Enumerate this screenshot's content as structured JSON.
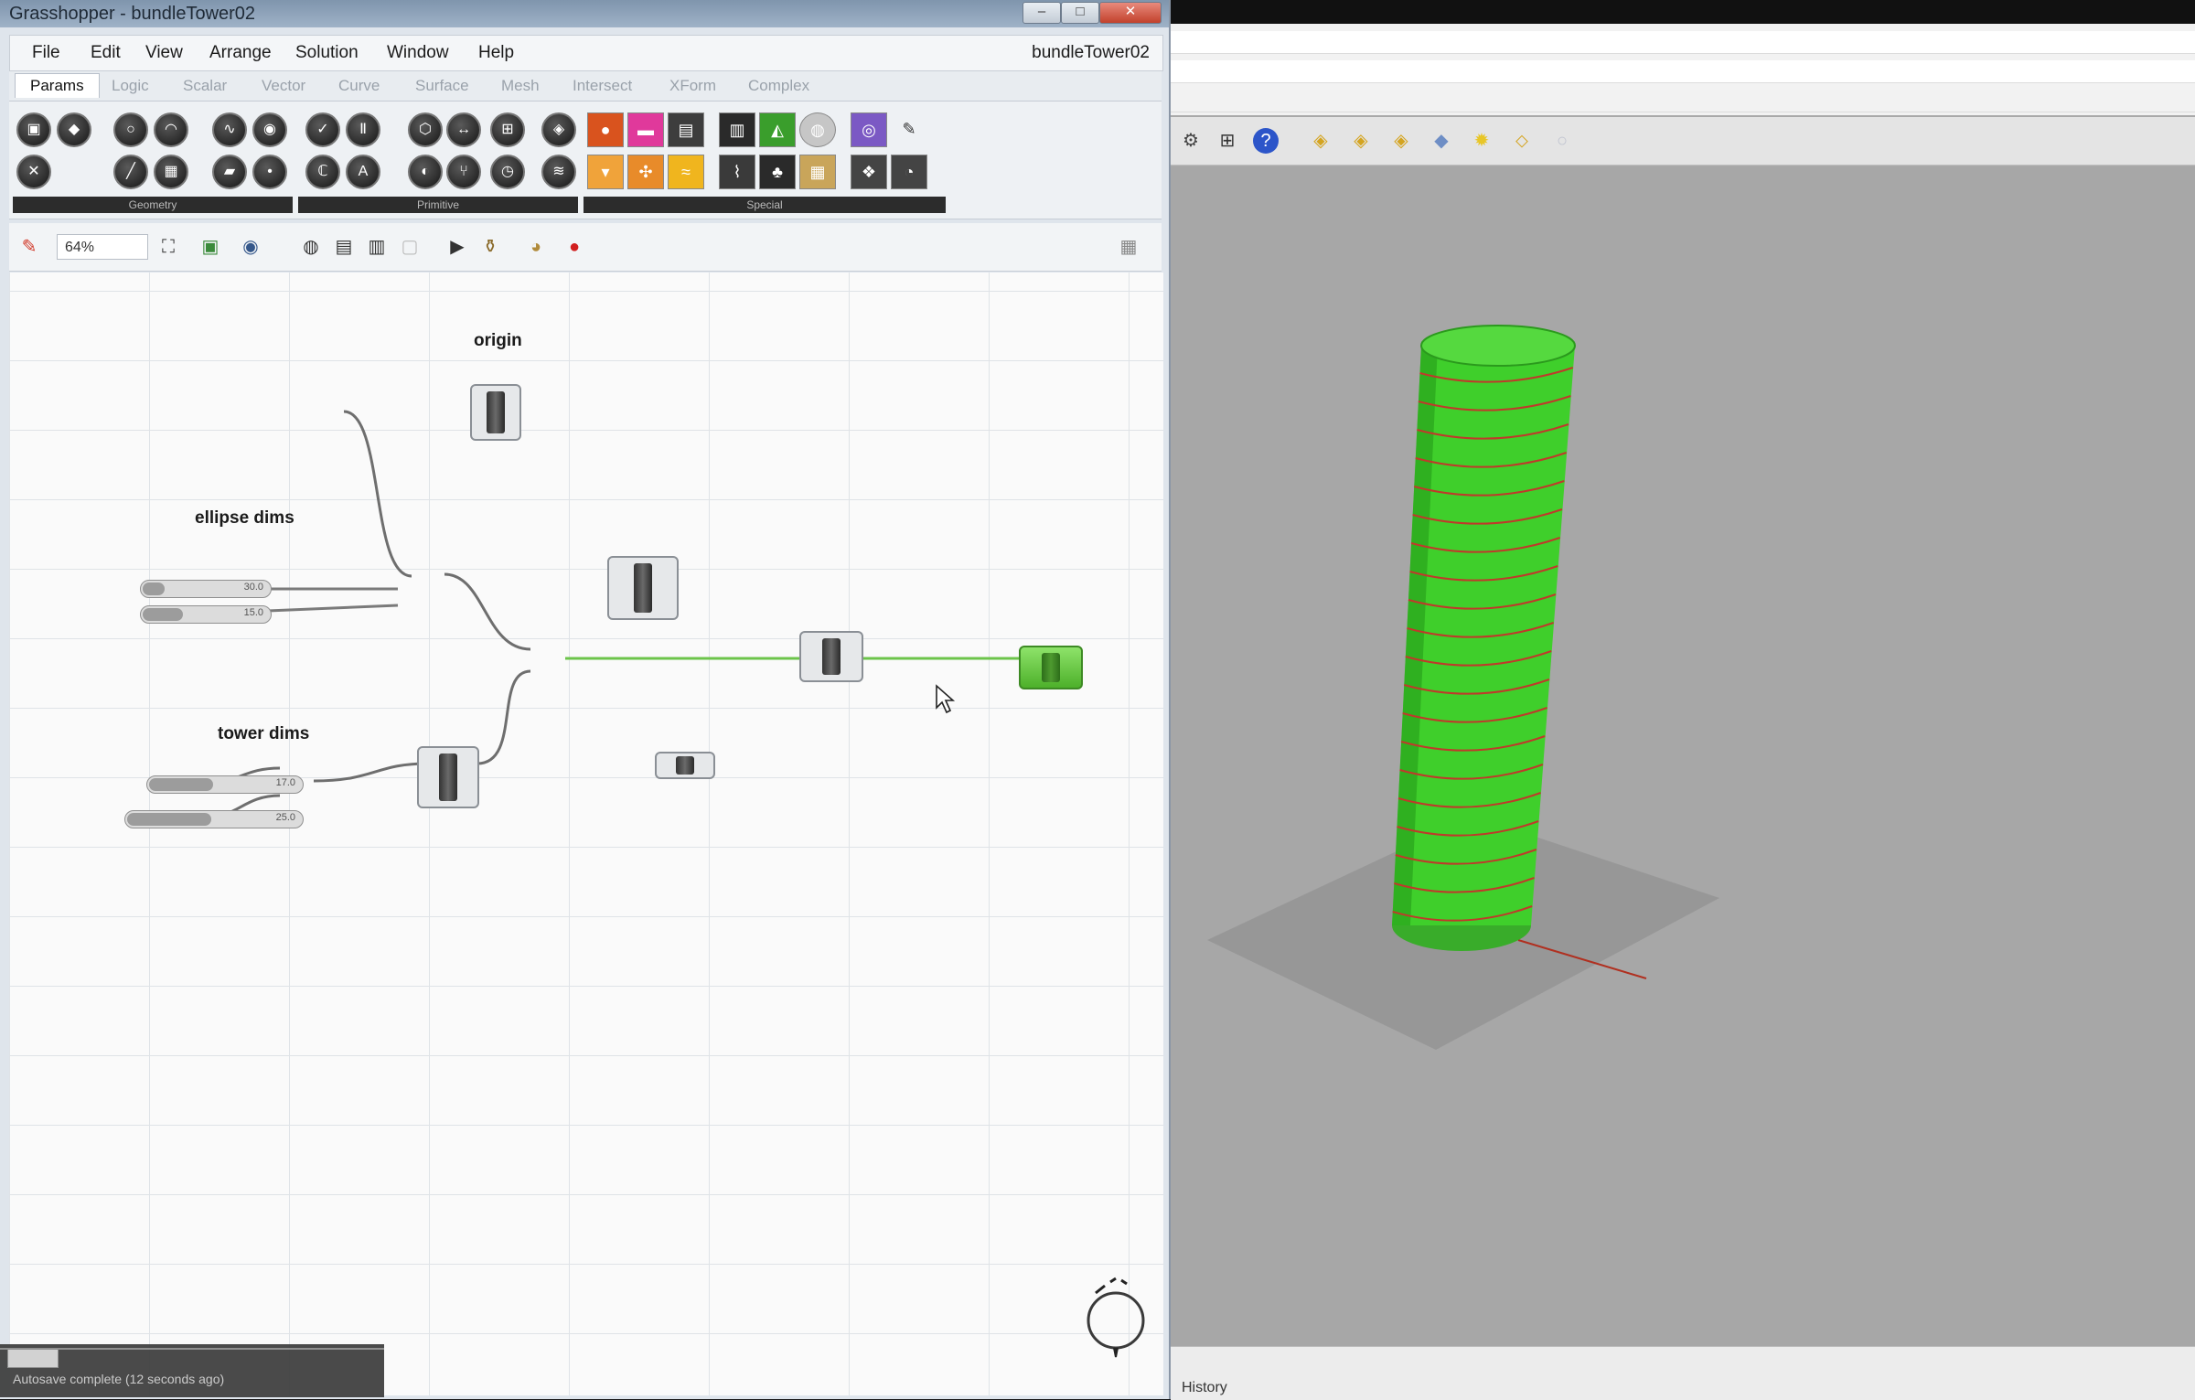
{
  "grasshopper": {
    "title": "Grasshopper - bundleTower02",
    "document_name": "bundleTower02",
    "menu": [
      "File",
      "Edit",
      "View",
      "Arrange",
      "Solution",
      "Window",
      "Help"
    ],
    "tabs": [
      "Params",
      "Logic",
      "Scalar",
      "Vector",
      "Curve",
      "Surface",
      "Mesh",
      "Intersect",
      "XForm",
      "Complex"
    ],
    "active_tab": "Params",
    "ribbon_groups": [
      "Geometry",
      "Primitive",
      "Special"
    ],
    "zoom": "64%",
    "groups": {
      "origin": "origin",
      "ellipse": "ellipse dims",
      "tower": "tower dims"
    },
    "sliders": {
      "ellipse_1": "30.0",
      "ellipse_2": "15.0",
      "tower_1": "17.0",
      "tower_2": "25.0"
    },
    "status_text": "Autosave complete (12 seconds ago)",
    "accent_wire_color": "#6cc44a",
    "preview_color": "#5fcf3a"
  },
  "rhino": {
    "status_history": "History",
    "object_color": "#39d129",
    "stripe_color": "#c0392b"
  }
}
